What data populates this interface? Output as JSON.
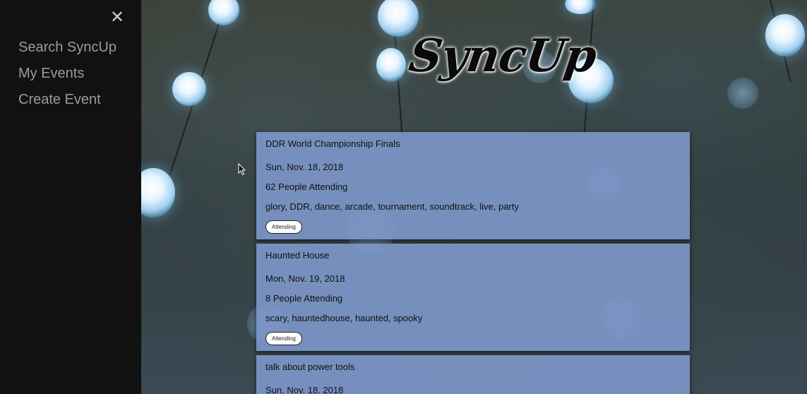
{
  "sidebar": {
    "close_icon": "close-icon",
    "close_glyph": "✕",
    "links": [
      {
        "label": "Search SyncUp"
      },
      {
        "label": "My Events"
      },
      {
        "label": "Create Event"
      }
    ]
  },
  "header": {
    "logo_text": "SyncUp"
  },
  "events": [
    {
      "title": "DDR World Championship Finals",
      "date": "Sun, Nov. 18, 2018",
      "attending": "62 People Attending",
      "tags": "glory, DDR, dance, arcade, tournament, soundtrack, live, party",
      "button": "Attending"
    },
    {
      "title": "Haunted House",
      "date": "Mon, Nov. 19, 2018",
      "attending": "8 People Attending",
      "tags": "scary, hauntedhouse, haunted, spooky",
      "button": "Attending"
    },
    {
      "title": "talk about power tools",
      "date": "Sun, Nov. 18, 2018"
    }
  ],
  "colors": {
    "sidebar_bg": "#111111",
    "nav_text": "#9b9b9b",
    "card_bg": "#7c96c8"
  }
}
